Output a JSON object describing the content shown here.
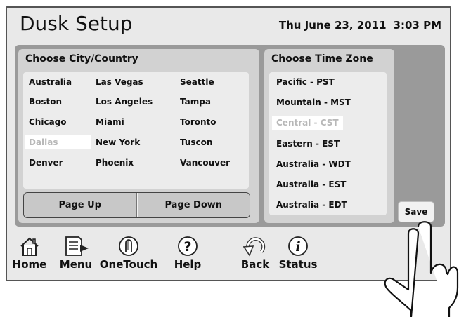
{
  "header": {
    "title": "Dusk Setup",
    "date": "Thu June 23, 2011",
    "time": "3:03 PM"
  },
  "city_panel": {
    "title": "Choose City/Country",
    "columns": [
      [
        "Australia",
        "Boston",
        "Chicago",
        "Dallas",
        "Denver"
      ],
      [
        "Las Vegas",
        "Los Angeles",
        "Miami",
        "New York",
        "Phoenix"
      ],
      [
        "Seattle",
        "Tampa",
        "Toronto",
        "Tuscon",
        "Vancouver"
      ]
    ],
    "selected": "Dallas",
    "page_up": "Page Up",
    "page_down": "Page Down"
  },
  "timezone_panel": {
    "title": "Choose Time Zone",
    "items": [
      "Pacific - PST",
      "Mountain - MST",
      "Central - CST",
      "Eastern - EST",
      "Australia - WDT",
      "Australia - EST",
      "Australia - EDT"
    ],
    "selected": "Central - CST"
  },
  "save_label": "Save",
  "toolbar": {
    "home": "Home",
    "menu": "Menu",
    "onetouch": "OneTouch",
    "help": "Help",
    "back": "Back",
    "status": "Status"
  },
  "icons": {
    "home": "house-icon",
    "menu": "document-menu-icon",
    "onetouch": "touch-button-icon",
    "help": "question-circle-icon",
    "back": "curved-arrow-icon",
    "status": "info-circle-icon",
    "pointer": "pointing-hand-icon"
  },
  "colors": {
    "panel_bg": "#9a9a9a",
    "list_bg": "#ececec",
    "selected_text": "#b8b8b8"
  }
}
